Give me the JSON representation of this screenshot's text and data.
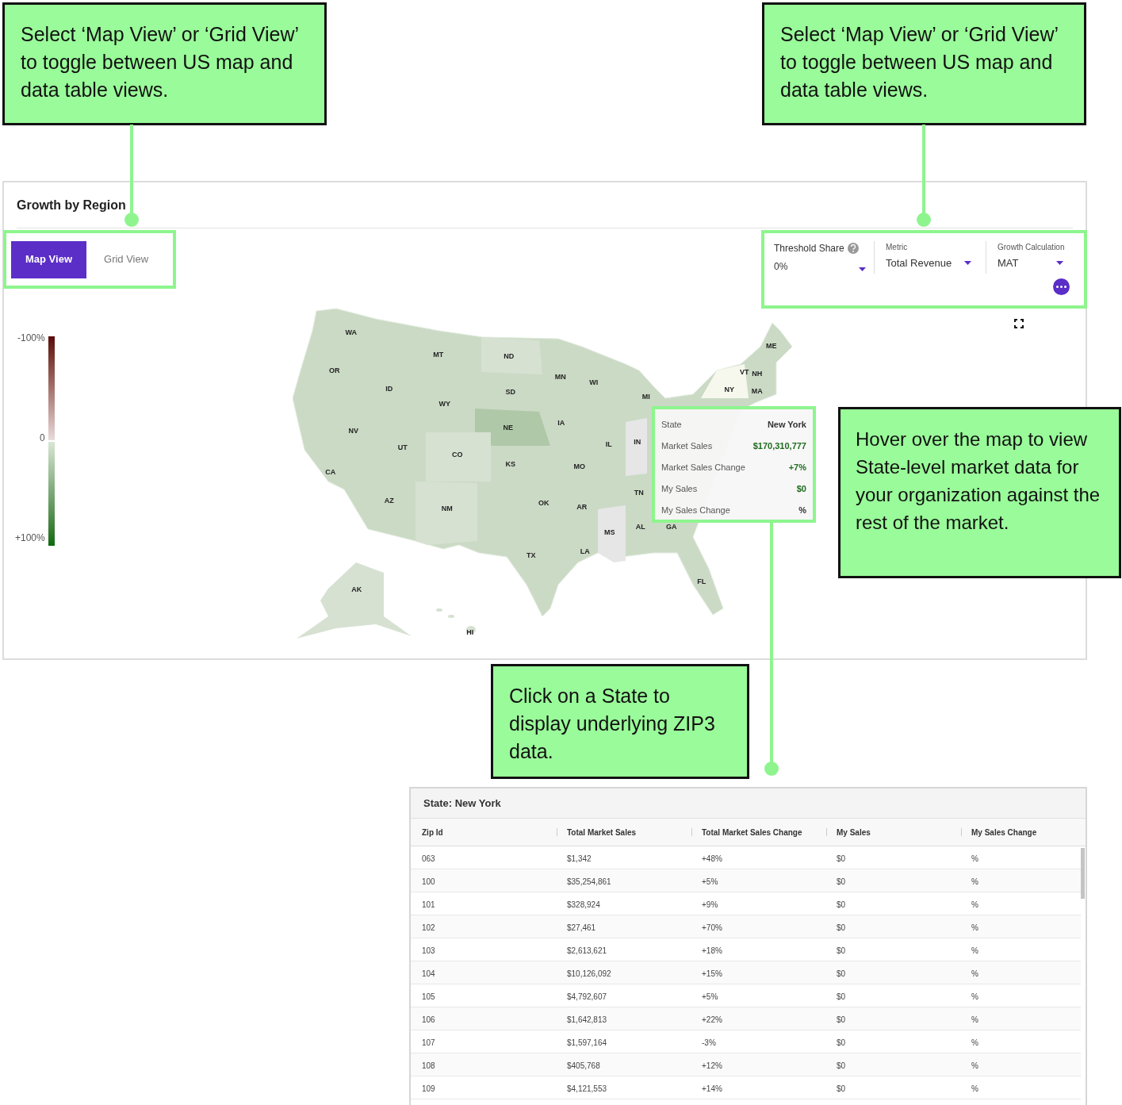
{
  "annotations": [
    {
      "text": "Select ‘Map View’ or ‘Grid View’ to toggle between US map and data table views."
    },
    {
      "text": "Select ‘Map View’ or ‘Grid View’ to toggle between US map and data table views."
    },
    {
      "text": "Hover over the map to view State-level market data for your organization against the rest of the market."
    },
    {
      "text": "Click on a State to display underlying ZIP3 data."
    }
  ],
  "panel": {
    "title": "Growth by Region",
    "view_tabs": [
      {
        "label": "Map View",
        "selected": true
      },
      {
        "label": "Grid View",
        "selected": false
      }
    ],
    "filters": [
      {
        "kind": "threshold",
        "label": "Threshold Share",
        "value": "0%"
      },
      {
        "kind": "select",
        "label": "Metric",
        "value": "Total Revenue"
      },
      {
        "kind": "select",
        "label": "Growth Calculation",
        "value": "MAT"
      }
    ],
    "legend": [
      "-100%",
      "0",
      "+100%"
    ],
    "map_labels": [
      "WA",
      "OR",
      "CA",
      "NV",
      "ID",
      "MT",
      "WY",
      "UT",
      "AZ",
      "CO",
      "NM",
      "ND",
      "SD",
      "NE",
      "KS",
      "OK",
      "TX",
      "MN",
      "IA",
      "MO",
      "AR",
      "LA",
      "WI",
      "IL",
      "IN",
      "MI",
      "TN",
      "MS",
      "AL",
      "GA",
      "FL",
      "ME",
      "VT",
      "NH",
      "NY",
      "MA",
      "AK",
      "HI"
    ],
    "tooltip": [
      {
        "kind": "heading",
        "label": "State",
        "value": "New York"
      },
      {
        "kind": "positive",
        "label": "Market Sales",
        "value": "$170,310,777"
      },
      {
        "kind": "positive",
        "label": "Market Sales Change",
        "value": "+7%"
      },
      {
        "kind": "positive",
        "label": "My Sales",
        "value": "$0"
      },
      {
        "kind": "plain",
        "label": "My Sales Change",
        "value": "%"
      }
    ]
  },
  "zip_table": {
    "title": "State: New York",
    "columns": [
      "Zip Id",
      "Total Market Sales",
      "Total Market Sales Change",
      "My Sales",
      "My Sales Change"
    ],
    "rows": [
      [
        "063",
        "$1,342",
        "+48%",
        "$0",
        "%"
      ],
      [
        "100",
        "$35,254,861",
        "+5%",
        "$0",
        "%"
      ],
      [
        "101",
        "$328,924",
        "+9%",
        "$0",
        "%"
      ],
      [
        "102",
        "$27,461",
        "+70%",
        "$0",
        "%"
      ],
      [
        "103",
        "$2,613,621",
        "+18%",
        "$0",
        "%"
      ],
      [
        "104",
        "$10,126,092",
        "+15%",
        "$0",
        "%"
      ],
      [
        "105",
        "$4,792,607",
        "+5%",
        "$0",
        "%"
      ],
      [
        "106",
        "$1,642,813",
        "+22%",
        "$0",
        "%"
      ],
      [
        "107",
        "$1,597,164",
        "-3%",
        "$0",
        "%"
      ],
      [
        "108",
        "$405,768",
        "+12%",
        "$0",
        "%"
      ],
      [
        "109",
        "$4,121,553",
        "+14%",
        "$0",
        "%"
      ]
    ]
  }
}
